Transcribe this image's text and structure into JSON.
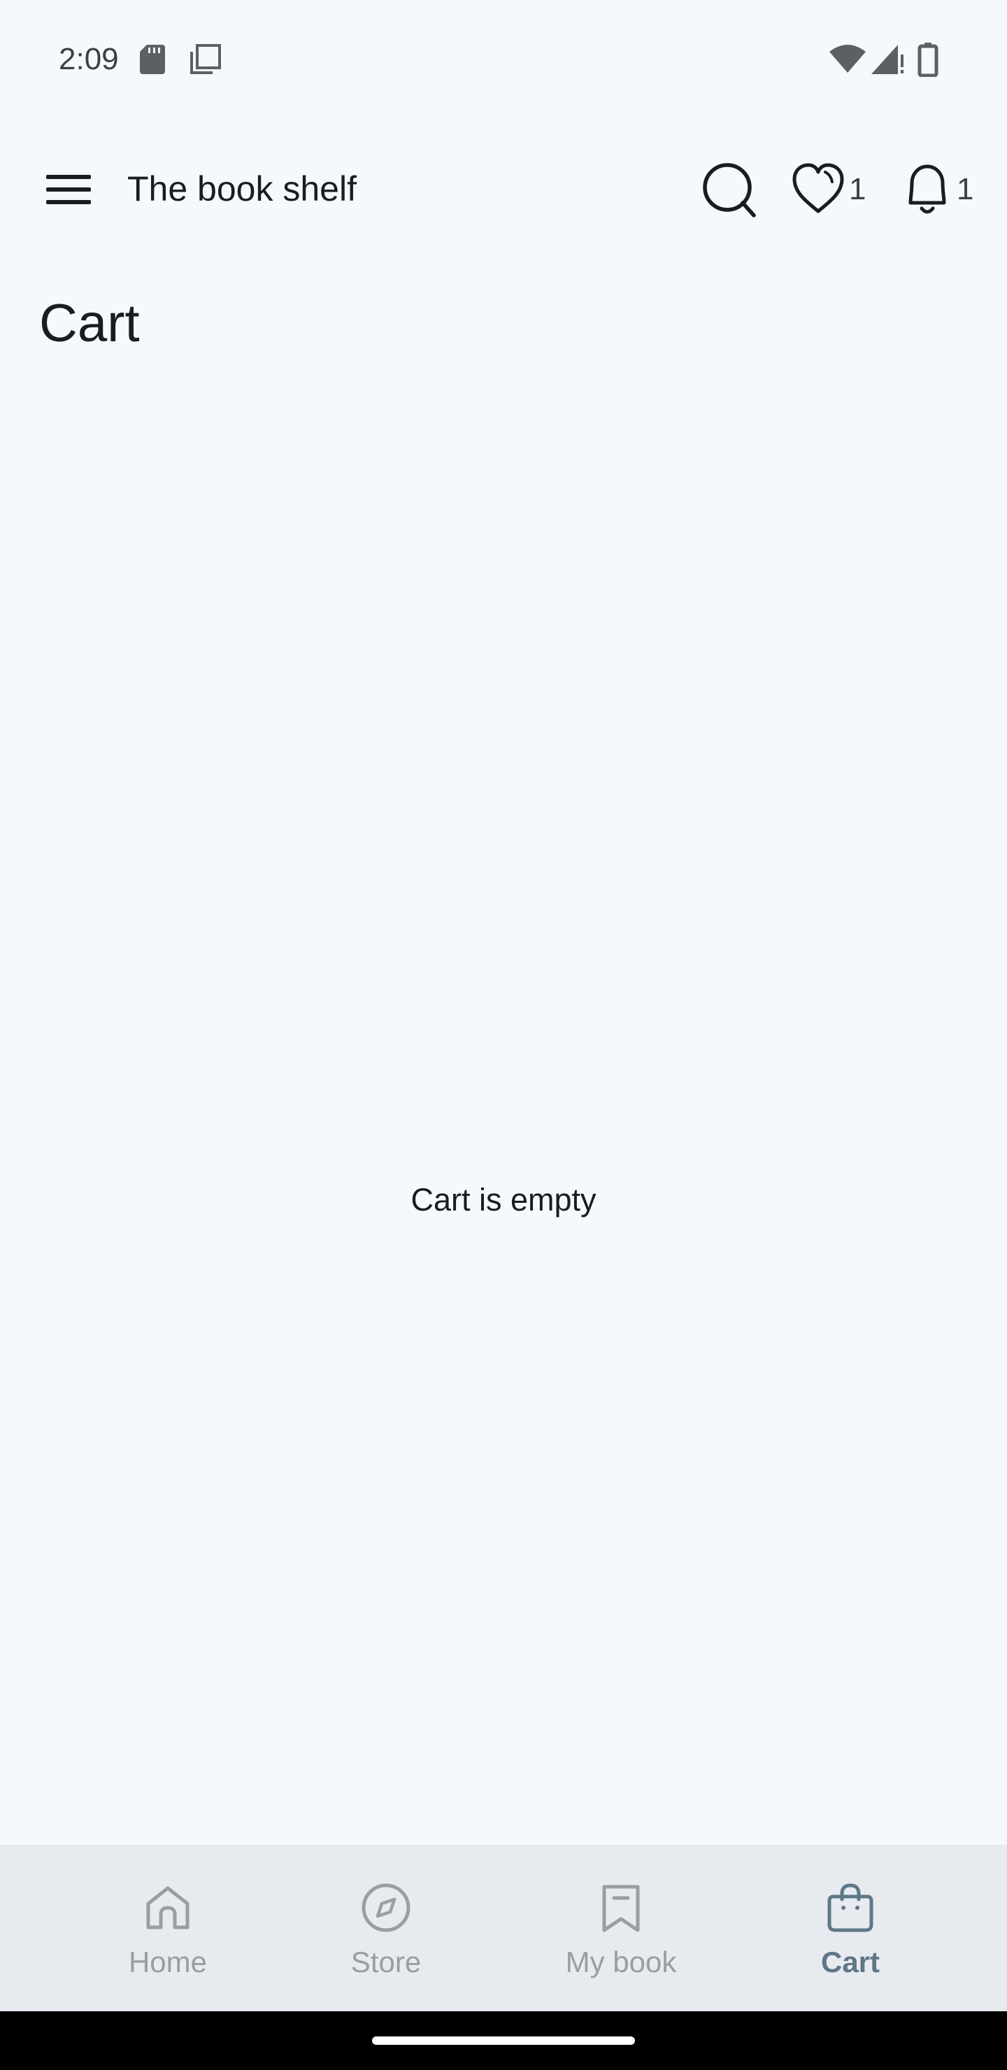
{
  "status_bar": {
    "time": "2:09",
    "left_icons": [
      "sd-card-icon",
      "screenshot-icon"
    ],
    "right_icons": [
      "wifi-icon",
      "cellular-signal-icon",
      "battery-icon"
    ]
  },
  "app_bar": {
    "title": "The book shelf",
    "menu_icon": "menu-icon",
    "search_icon": "search-icon",
    "favorites": {
      "icon": "heart-icon",
      "count": "1"
    },
    "notifications": {
      "icon": "bell-icon",
      "count": "1"
    }
  },
  "page": {
    "heading": "Cart",
    "empty_message": "Cart is empty"
  },
  "bottom_nav": {
    "items": [
      {
        "label": "Home",
        "icon": "home-icon",
        "active": false
      },
      {
        "label": "Store",
        "icon": "compass-icon",
        "active": false
      },
      {
        "label": "My book",
        "icon": "bookmark-icon",
        "active": false
      },
      {
        "label": "Cart",
        "icon": "shopping-bag-icon",
        "active": true
      }
    ]
  },
  "colors": {
    "background": "#f5f9fc",
    "nav_background": "#e7ebf0",
    "nav_active": "#5f7787",
    "nav_inactive": "#9a9ea3",
    "text": "#1b1c1f"
  }
}
